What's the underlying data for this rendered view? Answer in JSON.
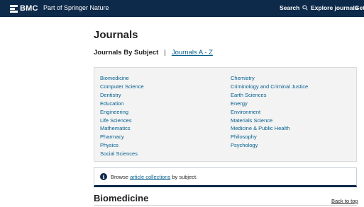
{
  "header": {
    "logo": "BMC",
    "tagline": "Part of Springer Nature",
    "nav": {
      "search": "Search",
      "explore": "Explore journals",
      "get": "Get"
    },
    "colors": {
      "bar": "#0e2a4a",
      "text": "#ffffff"
    }
  },
  "page": {
    "title": "Journals",
    "subnav": {
      "current": "Journals By Subject",
      "separator": "|",
      "link": "Journals A - Z"
    }
  },
  "subjects": {
    "left": [
      "Biomedicine",
      "Computer Science",
      "Dentistry",
      "Education",
      "Engineering",
      "Life Sciences",
      "Mathematics",
      "Pharmacy",
      "Physics",
      "Social Sciences"
    ],
    "right": [
      "Chemistry",
      "Criminology and Criminal Justice",
      "Earth Sciences",
      "Energy",
      "Environment",
      "Materials Science",
      "Medicine & Public Health",
      "Philosophy",
      "Psychology"
    ]
  },
  "info": {
    "icon": "info-icon",
    "prefix": "Browse",
    "link": "article collections",
    "suffix": "by subject."
  },
  "section": {
    "title": "Biomedicine",
    "back_to_top": "Back to top"
  },
  "accent": "#025e8d"
}
